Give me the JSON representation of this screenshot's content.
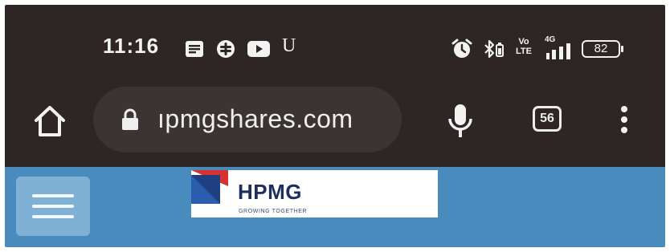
{
  "status_bar": {
    "time": "11:16",
    "left_icons": [
      "message-icon",
      "cast-icon",
      "youtube-icon",
      "u-app-icon"
    ],
    "u_icon_text": "U",
    "right_icons": [
      "alarm-icon",
      "bluetooth-icon",
      "volte-icon",
      "signal-4g-icon",
      "battery-icon"
    ],
    "volte_top": "Vo",
    "volte_bottom": "LTE",
    "network": "4G",
    "battery": "82"
  },
  "toolbar": {
    "url": "ıpmgshares.com",
    "tab_count": "56"
  },
  "page": {
    "logo_text": "HPMG",
    "logo_tagline": "GROWING TOGETHER"
  },
  "colors": {
    "chrome_bg": "#2d2624",
    "omnibox_bg": "#3b3432",
    "page_bg": "#4a8bbd",
    "hamburger_bg": "#7fb0d6",
    "logo_blue": "#1e2f5e",
    "logo_red": "#d6322f"
  }
}
